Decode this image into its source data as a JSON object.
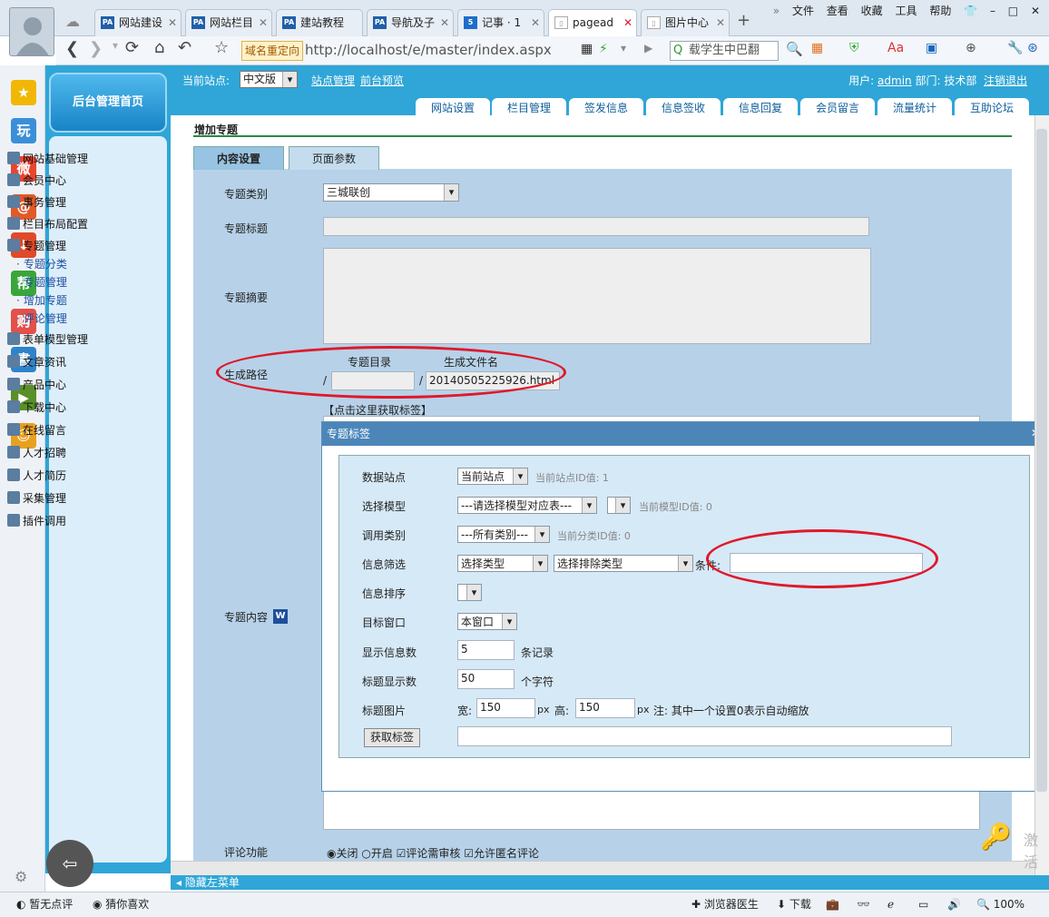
{
  "browser": {
    "tabs": [
      {
        "label": "网站建设"
      },
      {
        "label": "网站栏目"
      },
      {
        "label": "建站教程"
      },
      {
        "label": "导航及子"
      },
      {
        "label": "记事 · 1"
      },
      {
        "label": "pagead"
      },
      {
        "label": "图片中心"
      }
    ],
    "new_tab": "+",
    "menu": [
      "文件",
      "查看",
      "收藏",
      "工具",
      "帮助"
    ],
    "redirect_label": "域名重定向",
    "url": "http://localhost/e/master/index.aspx",
    "search_placeholder": "载学生中巴翻",
    "status": {
      "left1": "暂无点评",
      "left2": "猜你喜欢",
      "doctor": "浏览器医生",
      "download": "下载",
      "zoom": "100%"
    }
  },
  "side_icons": [
    {
      "name": "star-icon",
      "glyph": "★",
      "color": "#f2b705"
    },
    {
      "name": "play-icon",
      "glyph": "玩",
      "color": "#3b8fd8"
    },
    {
      "name": "weibo-icon",
      "glyph": "微",
      "color": "#e8452f"
    },
    {
      "name": "mail-icon",
      "glyph": "@",
      "color": "#e05a2a"
    },
    {
      "name": "download-icon",
      "glyph": "↓",
      "color": "#e04a2a"
    },
    {
      "name": "help-icon",
      "glyph": "帮",
      "color": "#3aa63a"
    },
    {
      "name": "shop-icon",
      "glyph": "购",
      "color": "#e4504a"
    },
    {
      "name": "book-icon",
      "glyph": "書",
      "color": "#2f83c9"
    },
    {
      "name": "video-icon",
      "glyph": "▶",
      "color": "#5a8f2a"
    },
    {
      "name": "face-icon",
      "glyph": "☺",
      "color": "#e8a020"
    }
  ],
  "app": {
    "home": "后台管理首页",
    "site_label": "当前站点:",
    "site_value": "中文版",
    "site_manage": "站点管理",
    "preview": "前台预览",
    "user_label": "用户:",
    "user": "admin",
    "dept": "部门: 技术部",
    "logout": "注销退出",
    "main_tabs": [
      "网站设置",
      "栏目管理",
      "签发信息",
      "信息签收",
      "信息回复",
      "会员留言",
      "流量统计",
      "互助论坛"
    ],
    "hide_menu": "◂ 隐藏左菜单"
  },
  "nav": {
    "items": [
      "网站基础管理",
      "会员中心",
      "事务管理",
      "栏目布局配置",
      "专题管理"
    ],
    "sub": [
      "专题分类",
      "专题管理",
      "增加专题",
      "评论管理"
    ],
    "items2": [
      "表单模型管理",
      "文章资讯",
      "产品中心",
      "下载中心",
      "在线留言",
      "人才招聘",
      "人才简历",
      "采集管理",
      "插件调用"
    ]
  },
  "form": {
    "title": "增加专题",
    "tab1": "内容设置",
    "tab2": "页面参数",
    "category_label": "专题类别",
    "category_value": "三城联创",
    "title_label": "专题标题",
    "summary_label": "专题摘要",
    "path_label": "生成路径",
    "dir_label": "专题目录",
    "file_label": "生成文件名",
    "slash": "/",
    "file_value": "20140505225926.html",
    "get_tag_link": "【点击这里获取标签】",
    "content_label": "专题内容",
    "comment_label": "评论功能",
    "opt_close": "关闭",
    "opt_open": "开启",
    "opt_review": "评论需审核",
    "opt_anon": "允许匿名评论"
  },
  "dialog": {
    "title": "专题标签",
    "rows": {
      "site_label": "数据站点",
      "site_value": "当前站点",
      "site_hint": "当前站点ID值: 1",
      "model_label": "选择模型",
      "model_value": "---请选择模型对应表---",
      "model_hint": "当前模型ID值: 0",
      "cat_label": "调用类别",
      "cat_value": "---所有类别---",
      "cat_hint": "当前分类ID值: 0",
      "filter_label": "信息筛选",
      "filter_value": "选择类型",
      "exclude_value": "选择排除类型",
      "cond_label": "条件:",
      "sort_label": "信息排序",
      "target_label": "目标窗口",
      "target_value": "本窗口",
      "count_label": "显示信息数",
      "count_value": "5",
      "count_unit": "条记录",
      "len_label": "标题显示数",
      "len_value": "50",
      "len_unit": "个字符",
      "img_label": "标题图片",
      "w_label": "宽:",
      "w_value": "150",
      "px1": "px",
      "h_label": "高:",
      "h_value": "150",
      "px2": "px",
      "img_note": "注: 其中一个设置0表示自动缩放",
      "get_button": "获取标签"
    }
  },
  "watermark": "激活"
}
